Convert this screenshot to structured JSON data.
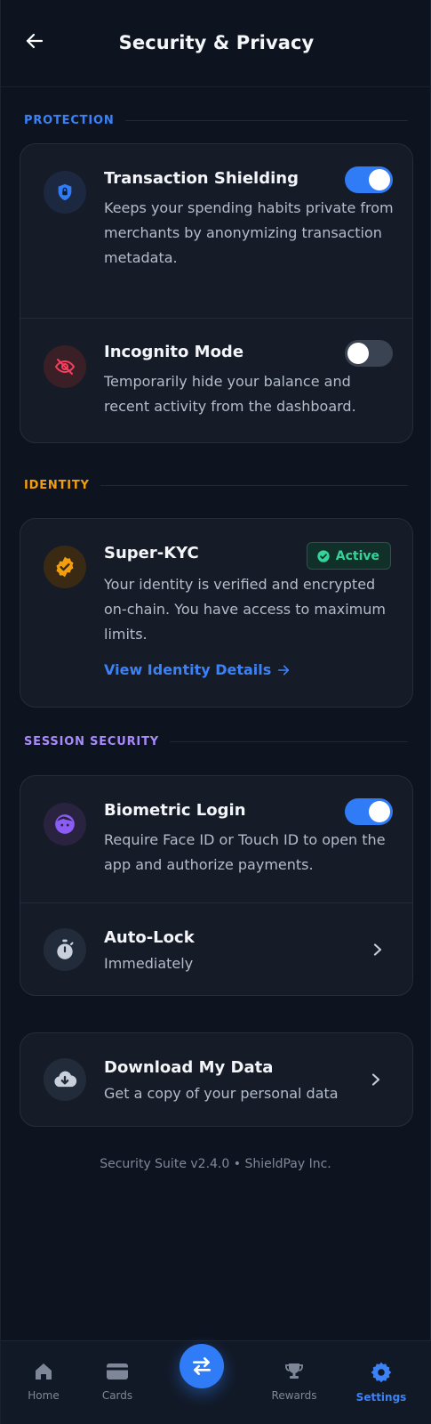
{
  "header": {
    "title": "Security & Privacy"
  },
  "sections": {
    "protection": {
      "label": "PROTECTION",
      "shielding": {
        "title": "Transaction Shielding",
        "description": "Keeps your spending habits private from merchants by anonymizing transaction metadata.",
        "enabled": true
      },
      "incognito": {
        "title": "Incognito Mode",
        "description": "Temporarily hide your balance and recent activity from the dashboard.",
        "enabled": false
      }
    },
    "identity": {
      "label": "IDENTITY",
      "kyc": {
        "title": "Super-KYC",
        "badge": "Active",
        "description": "Your identity is verified and encrypted on-chain. You have access to maximum limits.",
        "link": "View Identity Details"
      }
    },
    "session": {
      "label": "SESSION SECURITY",
      "biometric": {
        "title": "Biometric Login",
        "description": "Require Face ID or Touch ID to open the app and authorize payments.",
        "enabled": true
      },
      "autolock": {
        "title": "Auto-Lock",
        "value": "Immediately"
      }
    },
    "data": {
      "download": {
        "title": "Download My Data",
        "subtitle": "Get a copy of your personal data"
      }
    }
  },
  "footer": {
    "text": "Security Suite v2.4.0 • ShieldPay Inc."
  },
  "nav": {
    "items": [
      {
        "label": "Home",
        "icon": "home-icon"
      },
      {
        "label": "Cards",
        "icon": "card-icon"
      },
      {
        "label": "Rewards",
        "icon": "trophy-icon"
      },
      {
        "label": "Settings",
        "icon": "gear-icon",
        "active": true
      }
    ],
    "center_icon": "swap-arrows-icon"
  },
  "colors": {
    "background": "#0e141f",
    "card": "#161c27",
    "accent": "#2f7cf6",
    "protection_label": "#3b82f6",
    "identity_label": "#f59e0b",
    "session_label": "#a78bfa",
    "success": "#34d399",
    "danger": "#f43f5e"
  }
}
